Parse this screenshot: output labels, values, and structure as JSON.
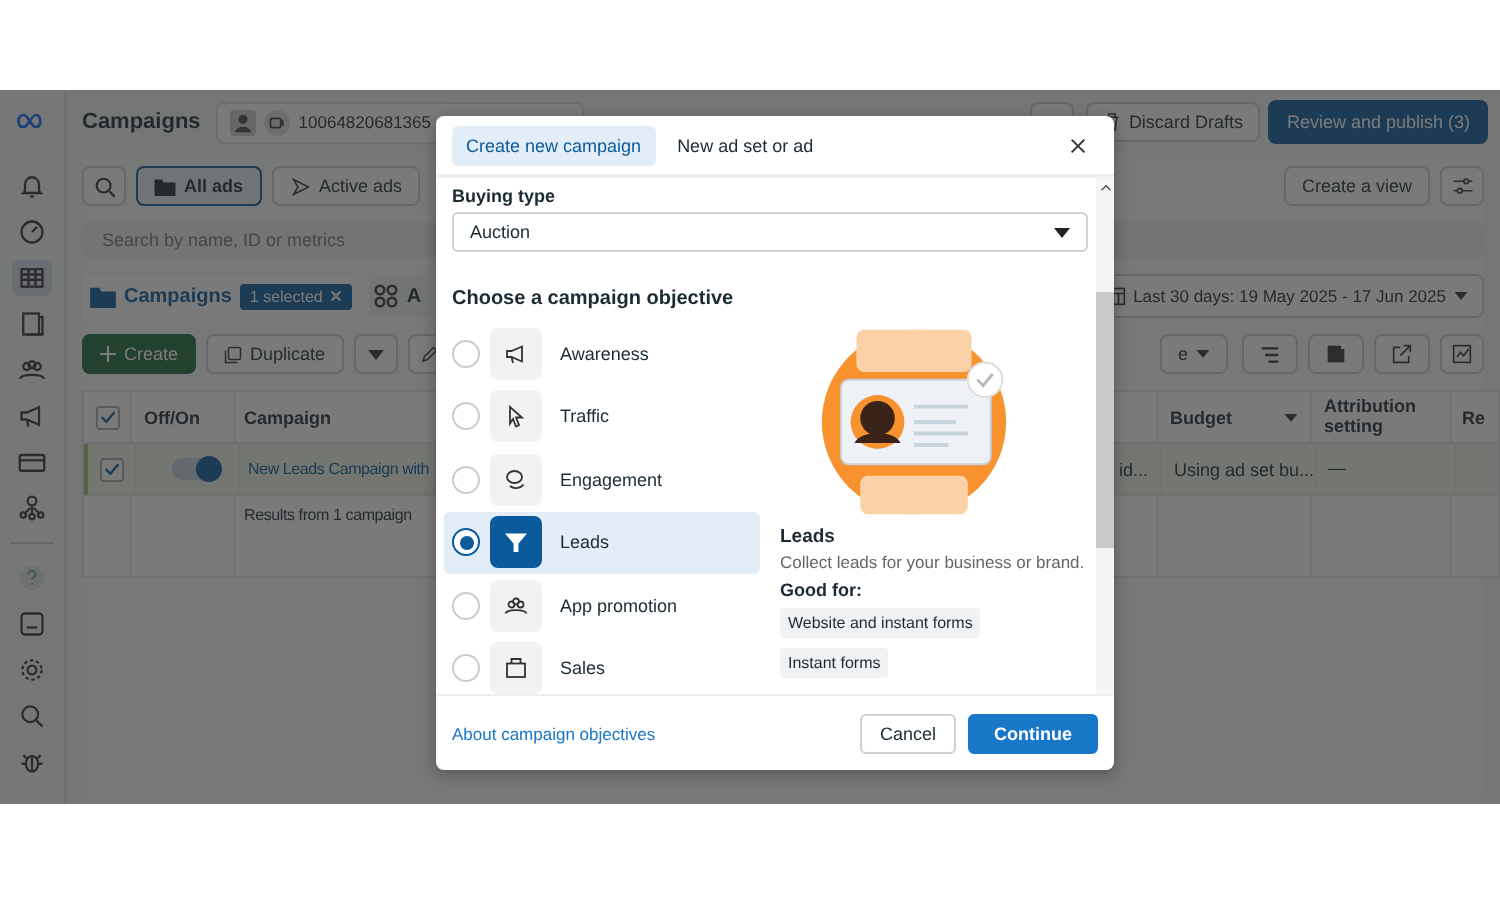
{
  "sidebar_items": [
    {
      "kind": "bell",
      "selected": false
    },
    {
      "kind": "gauge",
      "selected": false
    },
    {
      "kind": "table",
      "selected": true
    },
    {
      "kind": "pages",
      "selected": false
    },
    {
      "kind": "people",
      "selected": false
    },
    {
      "kind": "megaphone",
      "selected": false
    },
    {
      "kind": "card",
      "selected": false
    },
    {
      "kind": "network",
      "selected": false
    },
    {
      "kind": "help",
      "selected": false
    },
    {
      "kind": "image",
      "selected": false
    },
    {
      "kind": "gear",
      "selected": false
    },
    {
      "kind": "search",
      "selected": false
    },
    {
      "kind": "bug",
      "selected": false
    }
  ],
  "header": {
    "title": "Campaigns",
    "account_id": "10064820681365",
    "discard": "Discard Drafts",
    "publish": "Review and publish (3)"
  },
  "filters": [
    {
      "label": "All ads",
      "selected": true
    },
    {
      "label": "Active ads",
      "selected": false
    }
  ],
  "create_view": "Create a view",
  "search": {
    "placeholder": "Search by name, ID or metrics"
  },
  "level_tabs": [
    {
      "label": "Campaigns",
      "selected": true,
      "badge": "1 selected"
    },
    {
      "label": "A",
      "selected": false
    }
  ],
  "date_range": "Last 30 days: 19 May 2025 - 17 Jun 2025",
  "toolbar": {
    "create": "Create",
    "duplicate": "Duplicate",
    "cut_label": "e"
  },
  "table": {
    "all_checked": true,
    "columns": [
      "Off/On",
      "Campaign",
      "Budget",
      "Attribution setting",
      "Re"
    ],
    "rows": [
      {
        "checked": true,
        "on": true,
        "campaign": "New Leads Campaign with",
        "column_3": "id...",
        "budget": "Using ad set bu...",
        "attribution": "—"
      }
    ],
    "summary": "Results from 1 campaign"
  },
  "dialog": {
    "tabs": [
      {
        "label": "Create new campaign",
        "selected": true
      },
      {
        "label": "New ad set or ad",
        "selected": false
      }
    ],
    "buying_type": {
      "label": "Buying type",
      "value": "Auction"
    },
    "heading": "Choose a campaign objective",
    "objectives": [
      {
        "label": "Awareness",
        "kind": "megaphone",
        "selected": false
      },
      {
        "label": "Traffic",
        "kind": "cursor",
        "selected": false
      },
      {
        "label": "Engagement",
        "kind": "chat",
        "selected": false
      },
      {
        "label": "Leads",
        "kind": "funnel",
        "selected": true
      },
      {
        "label": "App promotion",
        "kind": "people",
        "selected": false
      },
      {
        "label": "Sales",
        "kind": "bag",
        "selected": false
      }
    ],
    "detail": {
      "title": "Leads",
      "description": "Collect leads for your business or brand.",
      "good_for": "Good for:",
      "tags": [
        "Website and instant forms",
        "Instant forms"
      ]
    },
    "link": "About campaign objectives",
    "buttons": [
      {
        "label": "Cancel",
        "kind": "secondary"
      },
      {
        "label": "Continue",
        "kind": "primary"
      }
    ]
  }
}
